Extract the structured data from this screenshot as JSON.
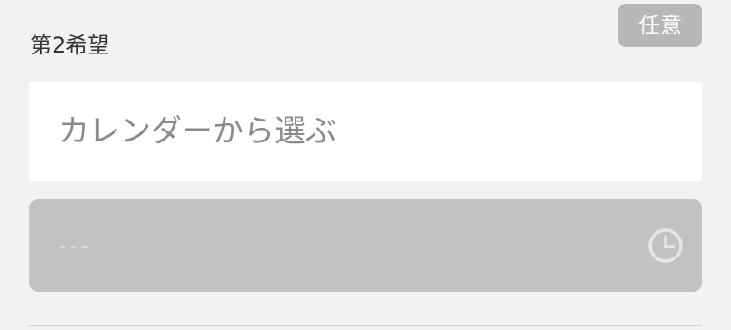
{
  "field": {
    "label": "第2希望",
    "badge": "任意"
  },
  "date_input": {
    "value": "",
    "placeholder": "カレンダーから選ぶ"
  },
  "time_select": {
    "value": "---",
    "icon": "clock-icon",
    "disabled": true
  },
  "colors": {
    "background": "#f2f2f2",
    "badge_bg": "#b7b7b7",
    "disabled_bg": "#c2c2c2",
    "input_bg": "#ffffff"
  }
}
